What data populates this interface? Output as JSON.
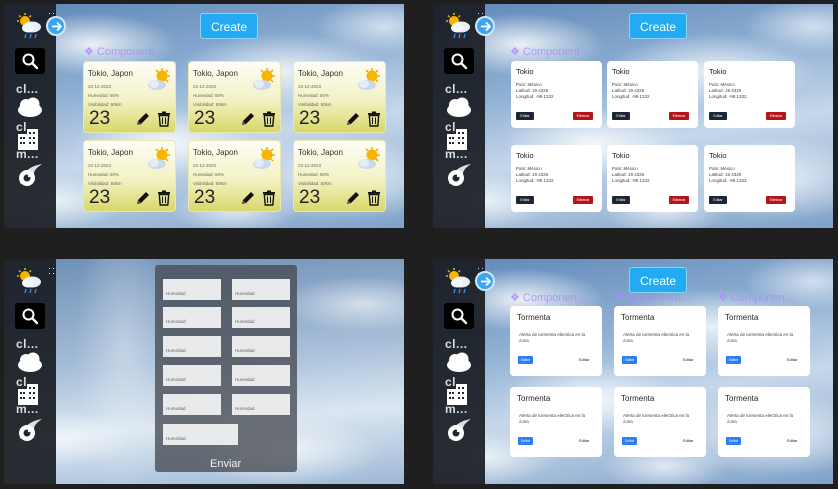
{
  "sidebar": {
    "labels": [
      "cl...",
      "cl...",
      "m..."
    ],
    "icons": [
      "weather-rain-sun-icon",
      "search-icon",
      "cloud-icon",
      "building-icon",
      "comet-icon"
    ]
  },
  "create_label": "Create",
  "component_label": "❖ Component",
  "component_label_long": "❖ Componen...",
  "weather_cards": [
    {
      "city": "Tokio, Japon",
      "date": "22-12-2023",
      "humidity": "Humedad: 50%",
      "visibility": "Visibilidad: 50km",
      "temp": "23"
    },
    {
      "city": "Tokio, Japon",
      "date": "22-12-2023",
      "humidity": "Humedad: 50%",
      "visibility": "Visibilidad: 50km",
      "temp": "23"
    },
    {
      "city": "Tokio, Japon",
      "date": "22-12-2023",
      "humidity": "Humedad: 50%",
      "visibility": "Visibilidad: 50km",
      "temp": "23"
    },
    {
      "city": "Tokio, Japon",
      "date": "22-12-2023",
      "humidity": "Humedad: 50%",
      "visibility": "Visibilidad: 50km",
      "temp": "23"
    },
    {
      "city": "Tokio, Japon",
      "date": "22-12-2023",
      "humidity": "Humedad: 50%",
      "visibility": "Visibilidad: 50km",
      "temp": "23"
    },
    {
      "city": "Tokio, Japon",
      "date": "22-12-2023",
      "humidity": "Humedad: 50%",
      "visibility": "Visibilidad: 50km",
      "temp": "23"
    }
  ],
  "info_cards": {
    "title": "Tokio",
    "country": "País: México",
    "latitude": "Latitud: 19.4326",
    "longitude": "Longitud: -99.1332",
    "edit_label": "Editar",
    "delete_label": "Eliminar"
  },
  "form": {
    "field_label": "Humedad",
    "submit_label": "Enviar"
  },
  "storm_cards": {
    "title": "Tormenta",
    "message": "Alerta de tormenta electrica en la zona",
    "edit_label": "Editar",
    "edit_label_2": "Editar"
  },
  "colors": {
    "accent": "#22aaf2",
    "sidebar": "#191c22",
    "delete": "#b3161a",
    "edit_dark": "#1d2733",
    "edit_blue": "#2d7ef0",
    "component": "#b18cff"
  }
}
